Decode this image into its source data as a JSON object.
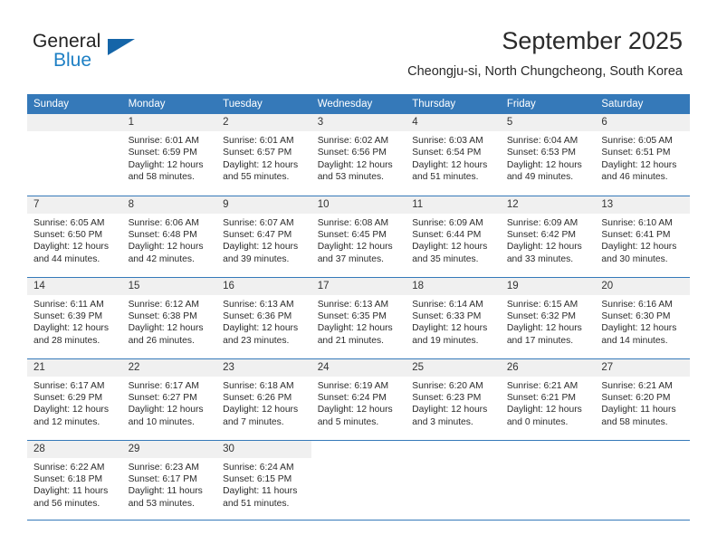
{
  "brand": {
    "name_part1": "General",
    "name_part2": "Blue",
    "logo_icon": "triangle-logo-icon",
    "accent_color": "#1d7fc4"
  },
  "header": {
    "title": "September 2025",
    "location": "Cheongju-si, North Chungcheong, South Korea"
  },
  "calendar": {
    "header_bg_color": "#3579b9",
    "daynum_bg_color": "#f0f0f0",
    "weekday_headers": [
      "Sunday",
      "Monday",
      "Tuesday",
      "Wednesday",
      "Thursday",
      "Friday",
      "Saturday"
    ],
    "weeks": [
      [
        {
          "day": "",
          "lines": []
        },
        {
          "day": "1",
          "lines": [
            "Sunrise: 6:01 AM",
            "Sunset: 6:59 PM",
            "Daylight: 12 hours",
            "and 58 minutes."
          ]
        },
        {
          "day": "2",
          "lines": [
            "Sunrise: 6:01 AM",
            "Sunset: 6:57 PM",
            "Daylight: 12 hours",
            "and 55 minutes."
          ]
        },
        {
          "day": "3",
          "lines": [
            "Sunrise: 6:02 AM",
            "Sunset: 6:56 PM",
            "Daylight: 12 hours",
            "and 53 minutes."
          ]
        },
        {
          "day": "4",
          "lines": [
            "Sunrise: 6:03 AM",
            "Sunset: 6:54 PM",
            "Daylight: 12 hours",
            "and 51 minutes."
          ]
        },
        {
          "day": "5",
          "lines": [
            "Sunrise: 6:04 AM",
            "Sunset: 6:53 PM",
            "Daylight: 12 hours",
            "and 49 minutes."
          ]
        },
        {
          "day": "6",
          "lines": [
            "Sunrise: 6:05 AM",
            "Sunset: 6:51 PM",
            "Daylight: 12 hours",
            "and 46 minutes."
          ]
        }
      ],
      [
        {
          "day": "7",
          "lines": [
            "Sunrise: 6:05 AM",
            "Sunset: 6:50 PM",
            "Daylight: 12 hours",
            "and 44 minutes."
          ]
        },
        {
          "day": "8",
          "lines": [
            "Sunrise: 6:06 AM",
            "Sunset: 6:48 PM",
            "Daylight: 12 hours",
            "and 42 minutes."
          ]
        },
        {
          "day": "9",
          "lines": [
            "Sunrise: 6:07 AM",
            "Sunset: 6:47 PM",
            "Daylight: 12 hours",
            "and 39 minutes."
          ]
        },
        {
          "day": "10",
          "lines": [
            "Sunrise: 6:08 AM",
            "Sunset: 6:45 PM",
            "Daylight: 12 hours",
            "and 37 minutes."
          ]
        },
        {
          "day": "11",
          "lines": [
            "Sunrise: 6:09 AM",
            "Sunset: 6:44 PM",
            "Daylight: 12 hours",
            "and 35 minutes."
          ]
        },
        {
          "day": "12",
          "lines": [
            "Sunrise: 6:09 AM",
            "Sunset: 6:42 PM",
            "Daylight: 12 hours",
            "and 33 minutes."
          ]
        },
        {
          "day": "13",
          "lines": [
            "Sunrise: 6:10 AM",
            "Sunset: 6:41 PM",
            "Daylight: 12 hours",
            "and 30 minutes."
          ]
        }
      ],
      [
        {
          "day": "14",
          "lines": [
            "Sunrise: 6:11 AM",
            "Sunset: 6:39 PM",
            "Daylight: 12 hours",
            "and 28 minutes."
          ]
        },
        {
          "day": "15",
          "lines": [
            "Sunrise: 6:12 AM",
            "Sunset: 6:38 PM",
            "Daylight: 12 hours",
            "and 26 minutes."
          ]
        },
        {
          "day": "16",
          "lines": [
            "Sunrise: 6:13 AM",
            "Sunset: 6:36 PM",
            "Daylight: 12 hours",
            "and 23 minutes."
          ]
        },
        {
          "day": "17",
          "lines": [
            "Sunrise: 6:13 AM",
            "Sunset: 6:35 PM",
            "Daylight: 12 hours",
            "and 21 minutes."
          ]
        },
        {
          "day": "18",
          "lines": [
            "Sunrise: 6:14 AM",
            "Sunset: 6:33 PM",
            "Daylight: 12 hours",
            "and 19 minutes."
          ]
        },
        {
          "day": "19",
          "lines": [
            "Sunrise: 6:15 AM",
            "Sunset: 6:32 PM",
            "Daylight: 12 hours",
            "and 17 minutes."
          ]
        },
        {
          "day": "20",
          "lines": [
            "Sunrise: 6:16 AM",
            "Sunset: 6:30 PM",
            "Daylight: 12 hours",
            "and 14 minutes."
          ]
        }
      ],
      [
        {
          "day": "21",
          "lines": [
            "Sunrise: 6:17 AM",
            "Sunset: 6:29 PM",
            "Daylight: 12 hours",
            "and 12 minutes."
          ]
        },
        {
          "day": "22",
          "lines": [
            "Sunrise: 6:17 AM",
            "Sunset: 6:27 PM",
            "Daylight: 12 hours",
            "and 10 minutes."
          ]
        },
        {
          "day": "23",
          "lines": [
            "Sunrise: 6:18 AM",
            "Sunset: 6:26 PM",
            "Daylight: 12 hours",
            "and 7 minutes."
          ]
        },
        {
          "day": "24",
          "lines": [
            "Sunrise: 6:19 AM",
            "Sunset: 6:24 PM",
            "Daylight: 12 hours",
            "and 5 minutes."
          ]
        },
        {
          "day": "25",
          "lines": [
            "Sunrise: 6:20 AM",
            "Sunset: 6:23 PM",
            "Daylight: 12 hours",
            "and 3 minutes."
          ]
        },
        {
          "day": "26",
          "lines": [
            "Sunrise: 6:21 AM",
            "Sunset: 6:21 PM",
            "Daylight: 12 hours",
            "and 0 minutes."
          ]
        },
        {
          "day": "27",
          "lines": [
            "Sunrise: 6:21 AM",
            "Sunset: 6:20 PM",
            "Daylight: 11 hours",
            "and 58 minutes."
          ]
        }
      ],
      [
        {
          "day": "28",
          "lines": [
            "Sunrise: 6:22 AM",
            "Sunset: 6:18 PM",
            "Daylight: 11 hours",
            "and 56 minutes."
          ]
        },
        {
          "day": "29",
          "lines": [
            "Sunrise: 6:23 AM",
            "Sunset: 6:17 PM",
            "Daylight: 11 hours",
            "and 53 minutes."
          ]
        },
        {
          "day": "30",
          "lines": [
            "Sunrise: 6:24 AM",
            "Sunset: 6:15 PM",
            "Daylight: 11 hours",
            "and 51 minutes."
          ]
        },
        {
          "day": "",
          "lines": []
        },
        {
          "day": "",
          "lines": []
        },
        {
          "day": "",
          "lines": []
        },
        {
          "day": "",
          "lines": []
        }
      ]
    ]
  }
}
